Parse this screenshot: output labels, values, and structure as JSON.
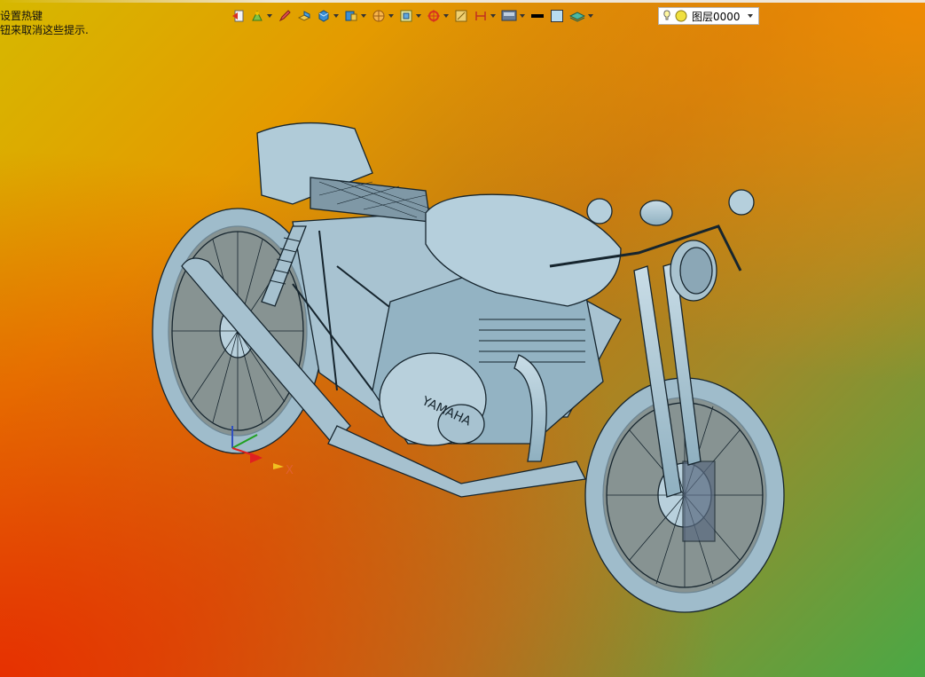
{
  "hints": {
    "line1": "设置热键",
    "line2": "钮来取消这些提示."
  },
  "toolbar": {
    "buttons": [
      {
        "name": "exit-sketch-icon"
      },
      {
        "name": "sketch-icon"
      },
      {
        "name": "pencil-icon"
      },
      {
        "name": "extrude-icon"
      },
      {
        "name": "solid-box-icon"
      },
      {
        "name": "feature-icon"
      },
      {
        "name": "render-icon"
      },
      {
        "name": "view-orient-icon"
      },
      {
        "name": "snap-icon"
      },
      {
        "name": "measure-icon"
      },
      {
        "name": "dimension-icon"
      },
      {
        "name": "display-icon"
      },
      {
        "name": "line-color-icon"
      },
      {
        "name": "fill-color-icon"
      },
      {
        "name": "layer-manager-icon"
      }
    ]
  },
  "layer": {
    "value": "图层0000"
  },
  "model": {
    "brand_label": "YAMAHA",
    "axis_x_label": "X",
    "colors": {
      "body": "#a9c6d4",
      "outline": "#16252e"
    }
  }
}
